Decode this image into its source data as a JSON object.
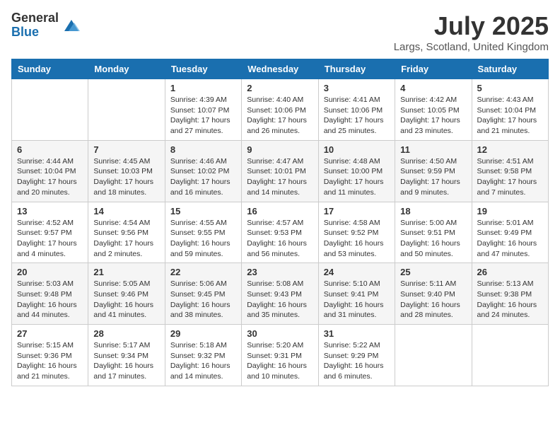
{
  "logo": {
    "general": "General",
    "blue": "Blue"
  },
  "title": "July 2025",
  "location": "Largs, Scotland, United Kingdom",
  "days_of_week": [
    "Sunday",
    "Monday",
    "Tuesday",
    "Wednesday",
    "Thursday",
    "Friday",
    "Saturday"
  ],
  "weeks": [
    [
      {
        "day": "",
        "info": ""
      },
      {
        "day": "",
        "info": ""
      },
      {
        "day": "1",
        "info": "Sunrise: 4:39 AM\nSunset: 10:07 PM\nDaylight: 17 hours and 27 minutes."
      },
      {
        "day": "2",
        "info": "Sunrise: 4:40 AM\nSunset: 10:06 PM\nDaylight: 17 hours and 26 minutes."
      },
      {
        "day": "3",
        "info": "Sunrise: 4:41 AM\nSunset: 10:06 PM\nDaylight: 17 hours and 25 minutes."
      },
      {
        "day": "4",
        "info": "Sunrise: 4:42 AM\nSunset: 10:05 PM\nDaylight: 17 hours and 23 minutes."
      },
      {
        "day": "5",
        "info": "Sunrise: 4:43 AM\nSunset: 10:04 PM\nDaylight: 17 hours and 21 minutes."
      }
    ],
    [
      {
        "day": "6",
        "info": "Sunrise: 4:44 AM\nSunset: 10:04 PM\nDaylight: 17 hours and 20 minutes."
      },
      {
        "day": "7",
        "info": "Sunrise: 4:45 AM\nSunset: 10:03 PM\nDaylight: 17 hours and 18 minutes."
      },
      {
        "day": "8",
        "info": "Sunrise: 4:46 AM\nSunset: 10:02 PM\nDaylight: 17 hours and 16 minutes."
      },
      {
        "day": "9",
        "info": "Sunrise: 4:47 AM\nSunset: 10:01 PM\nDaylight: 17 hours and 14 minutes."
      },
      {
        "day": "10",
        "info": "Sunrise: 4:48 AM\nSunset: 10:00 PM\nDaylight: 17 hours and 11 minutes."
      },
      {
        "day": "11",
        "info": "Sunrise: 4:50 AM\nSunset: 9:59 PM\nDaylight: 17 hours and 9 minutes."
      },
      {
        "day": "12",
        "info": "Sunrise: 4:51 AM\nSunset: 9:58 PM\nDaylight: 17 hours and 7 minutes."
      }
    ],
    [
      {
        "day": "13",
        "info": "Sunrise: 4:52 AM\nSunset: 9:57 PM\nDaylight: 17 hours and 4 minutes."
      },
      {
        "day": "14",
        "info": "Sunrise: 4:54 AM\nSunset: 9:56 PM\nDaylight: 17 hours and 2 minutes."
      },
      {
        "day": "15",
        "info": "Sunrise: 4:55 AM\nSunset: 9:55 PM\nDaylight: 16 hours and 59 minutes."
      },
      {
        "day": "16",
        "info": "Sunrise: 4:57 AM\nSunset: 9:53 PM\nDaylight: 16 hours and 56 minutes."
      },
      {
        "day": "17",
        "info": "Sunrise: 4:58 AM\nSunset: 9:52 PM\nDaylight: 16 hours and 53 minutes."
      },
      {
        "day": "18",
        "info": "Sunrise: 5:00 AM\nSunset: 9:51 PM\nDaylight: 16 hours and 50 minutes."
      },
      {
        "day": "19",
        "info": "Sunrise: 5:01 AM\nSunset: 9:49 PM\nDaylight: 16 hours and 47 minutes."
      }
    ],
    [
      {
        "day": "20",
        "info": "Sunrise: 5:03 AM\nSunset: 9:48 PM\nDaylight: 16 hours and 44 minutes."
      },
      {
        "day": "21",
        "info": "Sunrise: 5:05 AM\nSunset: 9:46 PM\nDaylight: 16 hours and 41 minutes."
      },
      {
        "day": "22",
        "info": "Sunrise: 5:06 AM\nSunset: 9:45 PM\nDaylight: 16 hours and 38 minutes."
      },
      {
        "day": "23",
        "info": "Sunrise: 5:08 AM\nSunset: 9:43 PM\nDaylight: 16 hours and 35 minutes."
      },
      {
        "day": "24",
        "info": "Sunrise: 5:10 AM\nSunset: 9:41 PM\nDaylight: 16 hours and 31 minutes."
      },
      {
        "day": "25",
        "info": "Sunrise: 5:11 AM\nSunset: 9:40 PM\nDaylight: 16 hours and 28 minutes."
      },
      {
        "day": "26",
        "info": "Sunrise: 5:13 AM\nSunset: 9:38 PM\nDaylight: 16 hours and 24 minutes."
      }
    ],
    [
      {
        "day": "27",
        "info": "Sunrise: 5:15 AM\nSunset: 9:36 PM\nDaylight: 16 hours and 21 minutes."
      },
      {
        "day": "28",
        "info": "Sunrise: 5:17 AM\nSunset: 9:34 PM\nDaylight: 16 hours and 17 minutes."
      },
      {
        "day": "29",
        "info": "Sunrise: 5:18 AM\nSunset: 9:32 PM\nDaylight: 16 hours and 14 minutes."
      },
      {
        "day": "30",
        "info": "Sunrise: 5:20 AM\nSunset: 9:31 PM\nDaylight: 16 hours and 10 minutes."
      },
      {
        "day": "31",
        "info": "Sunrise: 5:22 AM\nSunset: 9:29 PM\nDaylight: 16 hours and 6 minutes."
      },
      {
        "day": "",
        "info": ""
      },
      {
        "day": "",
        "info": ""
      }
    ]
  ]
}
